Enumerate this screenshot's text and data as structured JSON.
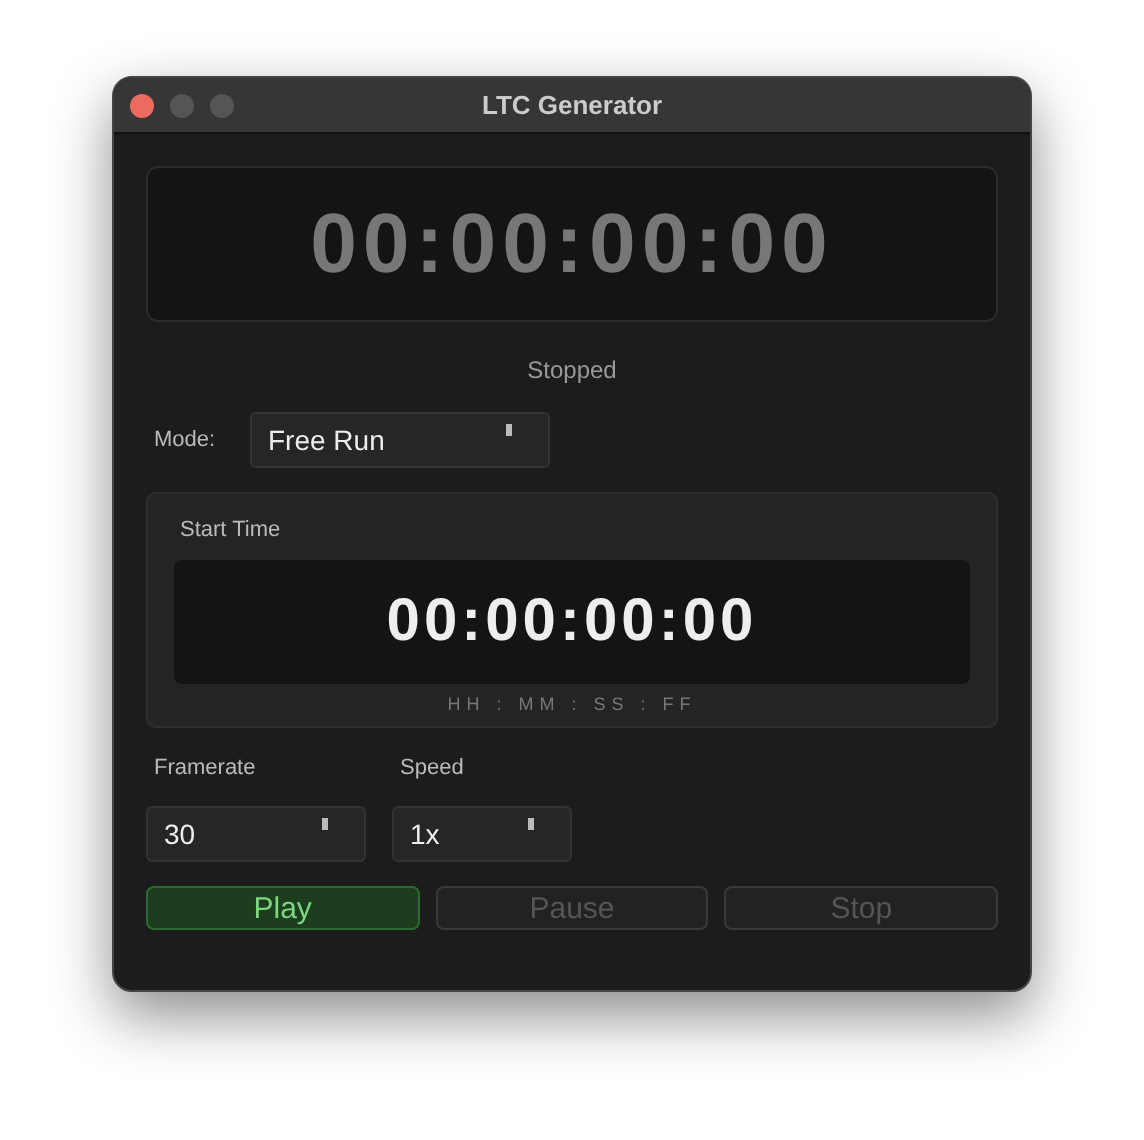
{
  "window": {
    "title": "LTC Generator"
  },
  "timecode": "00:00:00:00",
  "status": "Stopped",
  "mode": {
    "label": "Mode:",
    "value": "Free Run"
  },
  "start_time": {
    "label": "Start Time",
    "value": "00:00:00:00",
    "format": "HH : MM : SS : FF"
  },
  "framerate": {
    "label": "Framerate",
    "value": "30"
  },
  "speed": {
    "label": "Speed",
    "value": "1x"
  },
  "buttons": [
    {
      "label": "Play",
      "kind": "primary",
      "disabled": false
    },
    {
      "label": "Pause",
      "kind": "normal",
      "disabled": true
    },
    {
      "label": "Stop",
      "kind": "normal",
      "disabled": true
    }
  ]
}
